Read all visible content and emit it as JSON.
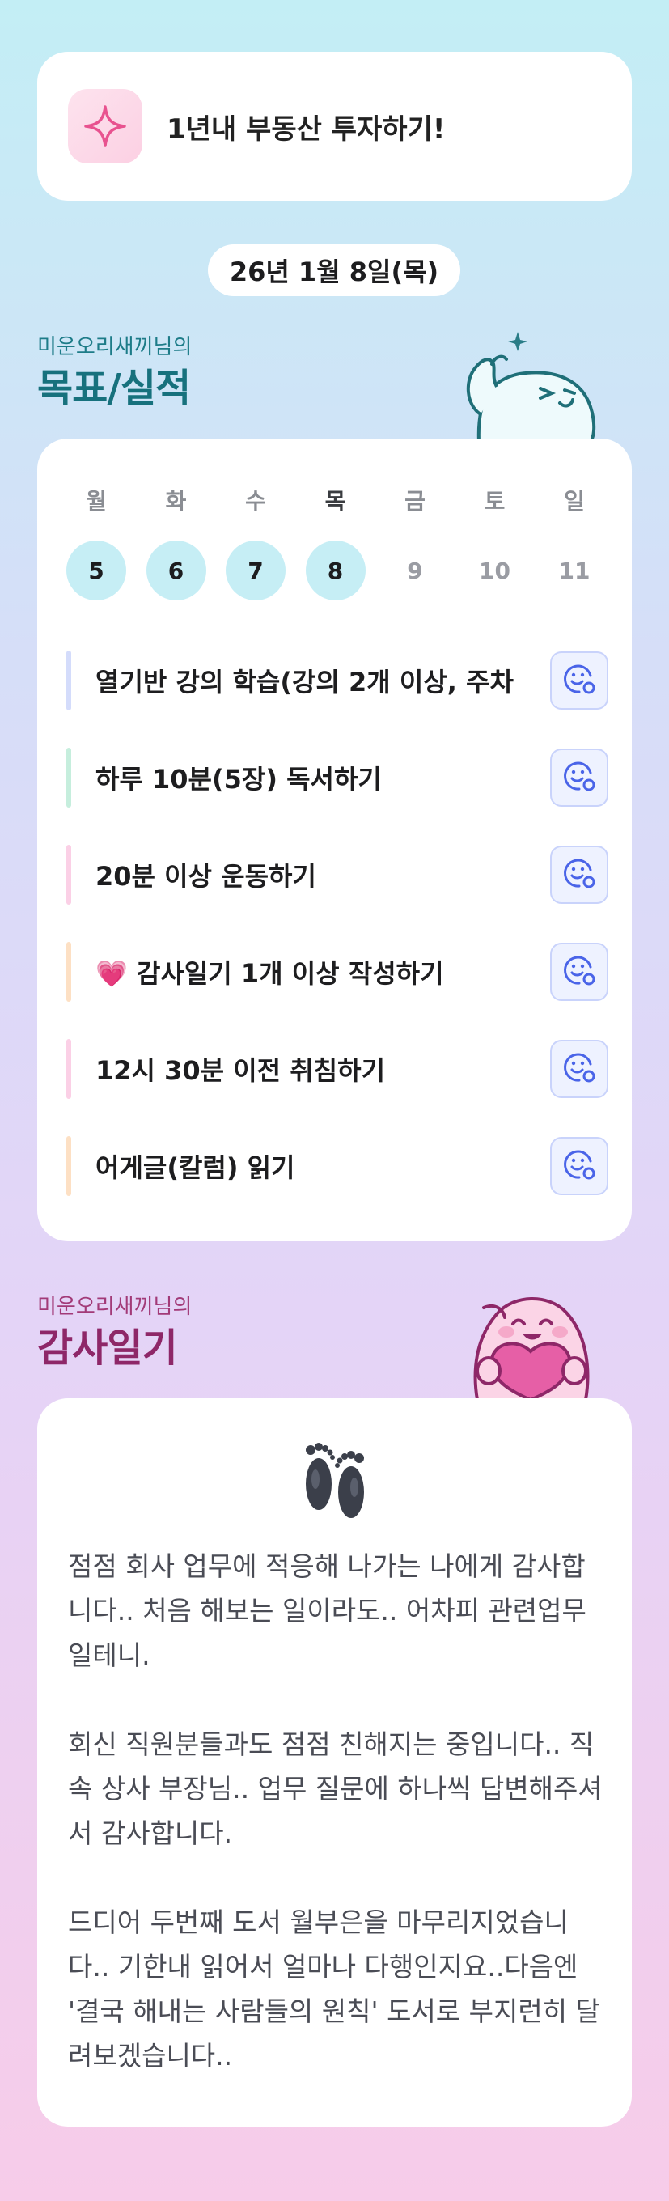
{
  "goal": {
    "icon": "sparkle-icon",
    "text": "1년내 부동산 투자하기!"
  },
  "date": "26년 1월 8일(목)",
  "goals_section": {
    "owner": "미운오리새끼님의",
    "title": "목표/실적"
  },
  "week": [
    {
      "name": "월",
      "num": "5",
      "state": "done"
    },
    {
      "name": "화",
      "num": "6",
      "state": "done"
    },
    {
      "name": "수",
      "num": "7",
      "state": "done"
    },
    {
      "name": "목",
      "num": "8",
      "state": "today"
    },
    {
      "name": "금",
      "num": "9",
      "state": "future"
    },
    {
      "name": "토",
      "num": "10",
      "state": "future"
    },
    {
      "name": "일",
      "num": "11",
      "state": "future"
    }
  ],
  "tasks": [
    {
      "label": "열기반 강의 학습(강의 2개 이상, 주차",
      "color": "#d4dcfb"
    },
    {
      "label": "하루 10분(5장) 독서하기",
      "color": "#c6eedd"
    },
    {
      "label": "20분 이상 운동하기",
      "color": "#fbd0e6"
    },
    {
      "label": "💗 감사일기 1개 이상 작성하기",
      "color": "#fde0c4"
    },
    {
      "label": "12시 30분 이전 취침하기",
      "color": "#fbd0e6"
    },
    {
      "label": "어게글(칼럼) 읽기",
      "color": "#fde0c4"
    }
  ],
  "diary_section": {
    "owner": "미운오리새끼님의",
    "title": "감사일기"
  },
  "diary": {
    "icon": "footprints-icon",
    "paragraphs": [
      "점점 회사 업무에 적응해 나가는 나에게 감사합니다.. 처음 해보는 일이라도.. 어차피 관련업무일테니.",
      "회신 직원분들과도 점점 친해지는 중입니다.. 직속 상사 부장님.. 업무 질문에 하나씩 답변해주셔서 감사합니다.",
      "드디어 두번째 도서 월부은을 마무리지었습니다.. 기한내 읽어서 얼마나 다행인지요..다음엔 '결국 해내는 사람들의 원칙' 도서로 부지런히 달려보겠습니다.."
    ]
  },
  "colors": {
    "accent_teal": "#17717d",
    "accent_magenta": "#8e2768",
    "done_day": "#c6eef5"
  }
}
